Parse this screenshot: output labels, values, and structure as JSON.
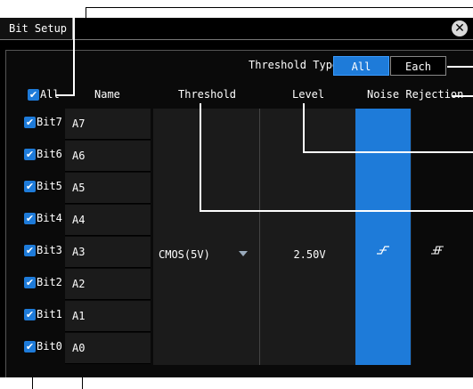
{
  "dialog": {
    "title": "Bit Setup",
    "close_glyph": "✕"
  },
  "threshold_type": {
    "label": "Threshold Type",
    "options": [
      "All",
      "Each"
    ],
    "selected": "All"
  },
  "headers": {
    "all_checkbox_label": "All",
    "name": "Name",
    "threshold": "Threshold",
    "level": "Level",
    "noise_rejection": "Noise Rejection"
  },
  "bits": [
    {
      "label": "Bit7",
      "name": "A7",
      "checked": true
    },
    {
      "label": "Bit6",
      "name": "A6",
      "checked": true
    },
    {
      "label": "Bit5",
      "name": "A5",
      "checked": true
    },
    {
      "label": "Bit4",
      "name": "A4",
      "checked": true
    },
    {
      "label": "Bit3",
      "name": "A3",
      "checked": true
    },
    {
      "label": "Bit2",
      "name": "A2",
      "checked": true
    },
    {
      "label": "Bit1",
      "name": "A1",
      "checked": true
    },
    {
      "label": "Bit0",
      "name": "A0",
      "checked": true
    }
  ],
  "settings": {
    "threshold_value": "CMOS(5V)",
    "level_value": "2.50V",
    "noise_rejection_options": [
      "noise-rejection-off-icon",
      "noise-rejection-on-icon"
    ],
    "noise_rejection_selected": "noise-rejection-off-icon"
  },
  "colors": {
    "accent": "#1e7bd9",
    "background": "#000000",
    "field": "#1b1b1b"
  }
}
